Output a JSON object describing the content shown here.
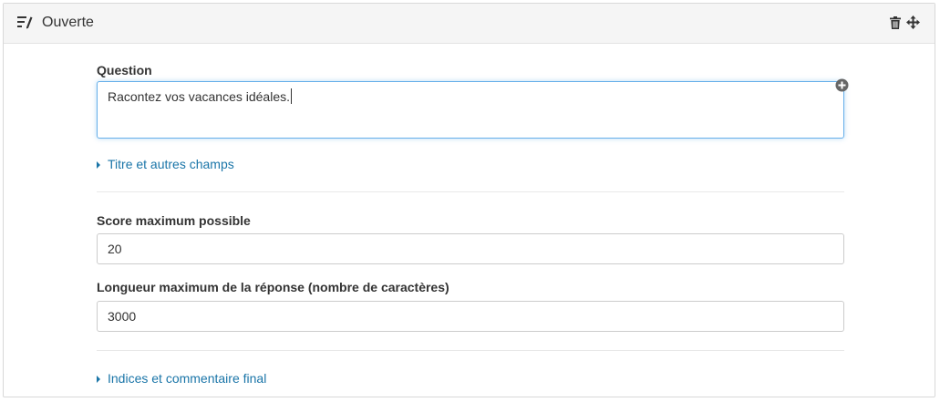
{
  "header": {
    "title": "Ouverte",
    "type_icon": "edit-list-icon",
    "actions": [
      "trash-icon",
      "move-icon"
    ]
  },
  "question": {
    "label": "Question",
    "value": "Racontez vos vacances idéales.",
    "add_icon": "plus-circle-icon"
  },
  "links": {
    "title_fields": "Titre et autres champs",
    "hints": "Indices et commentaire final"
  },
  "score": {
    "label": "Score maximum possible",
    "value": "20"
  },
  "max_length": {
    "label": "Longueur maximum de la réponse (nombre de caractères)",
    "value": "3000"
  },
  "colors": {
    "link": "#1a75a8",
    "focus_border": "#66afe9",
    "header_bg": "#f5f5f5"
  }
}
